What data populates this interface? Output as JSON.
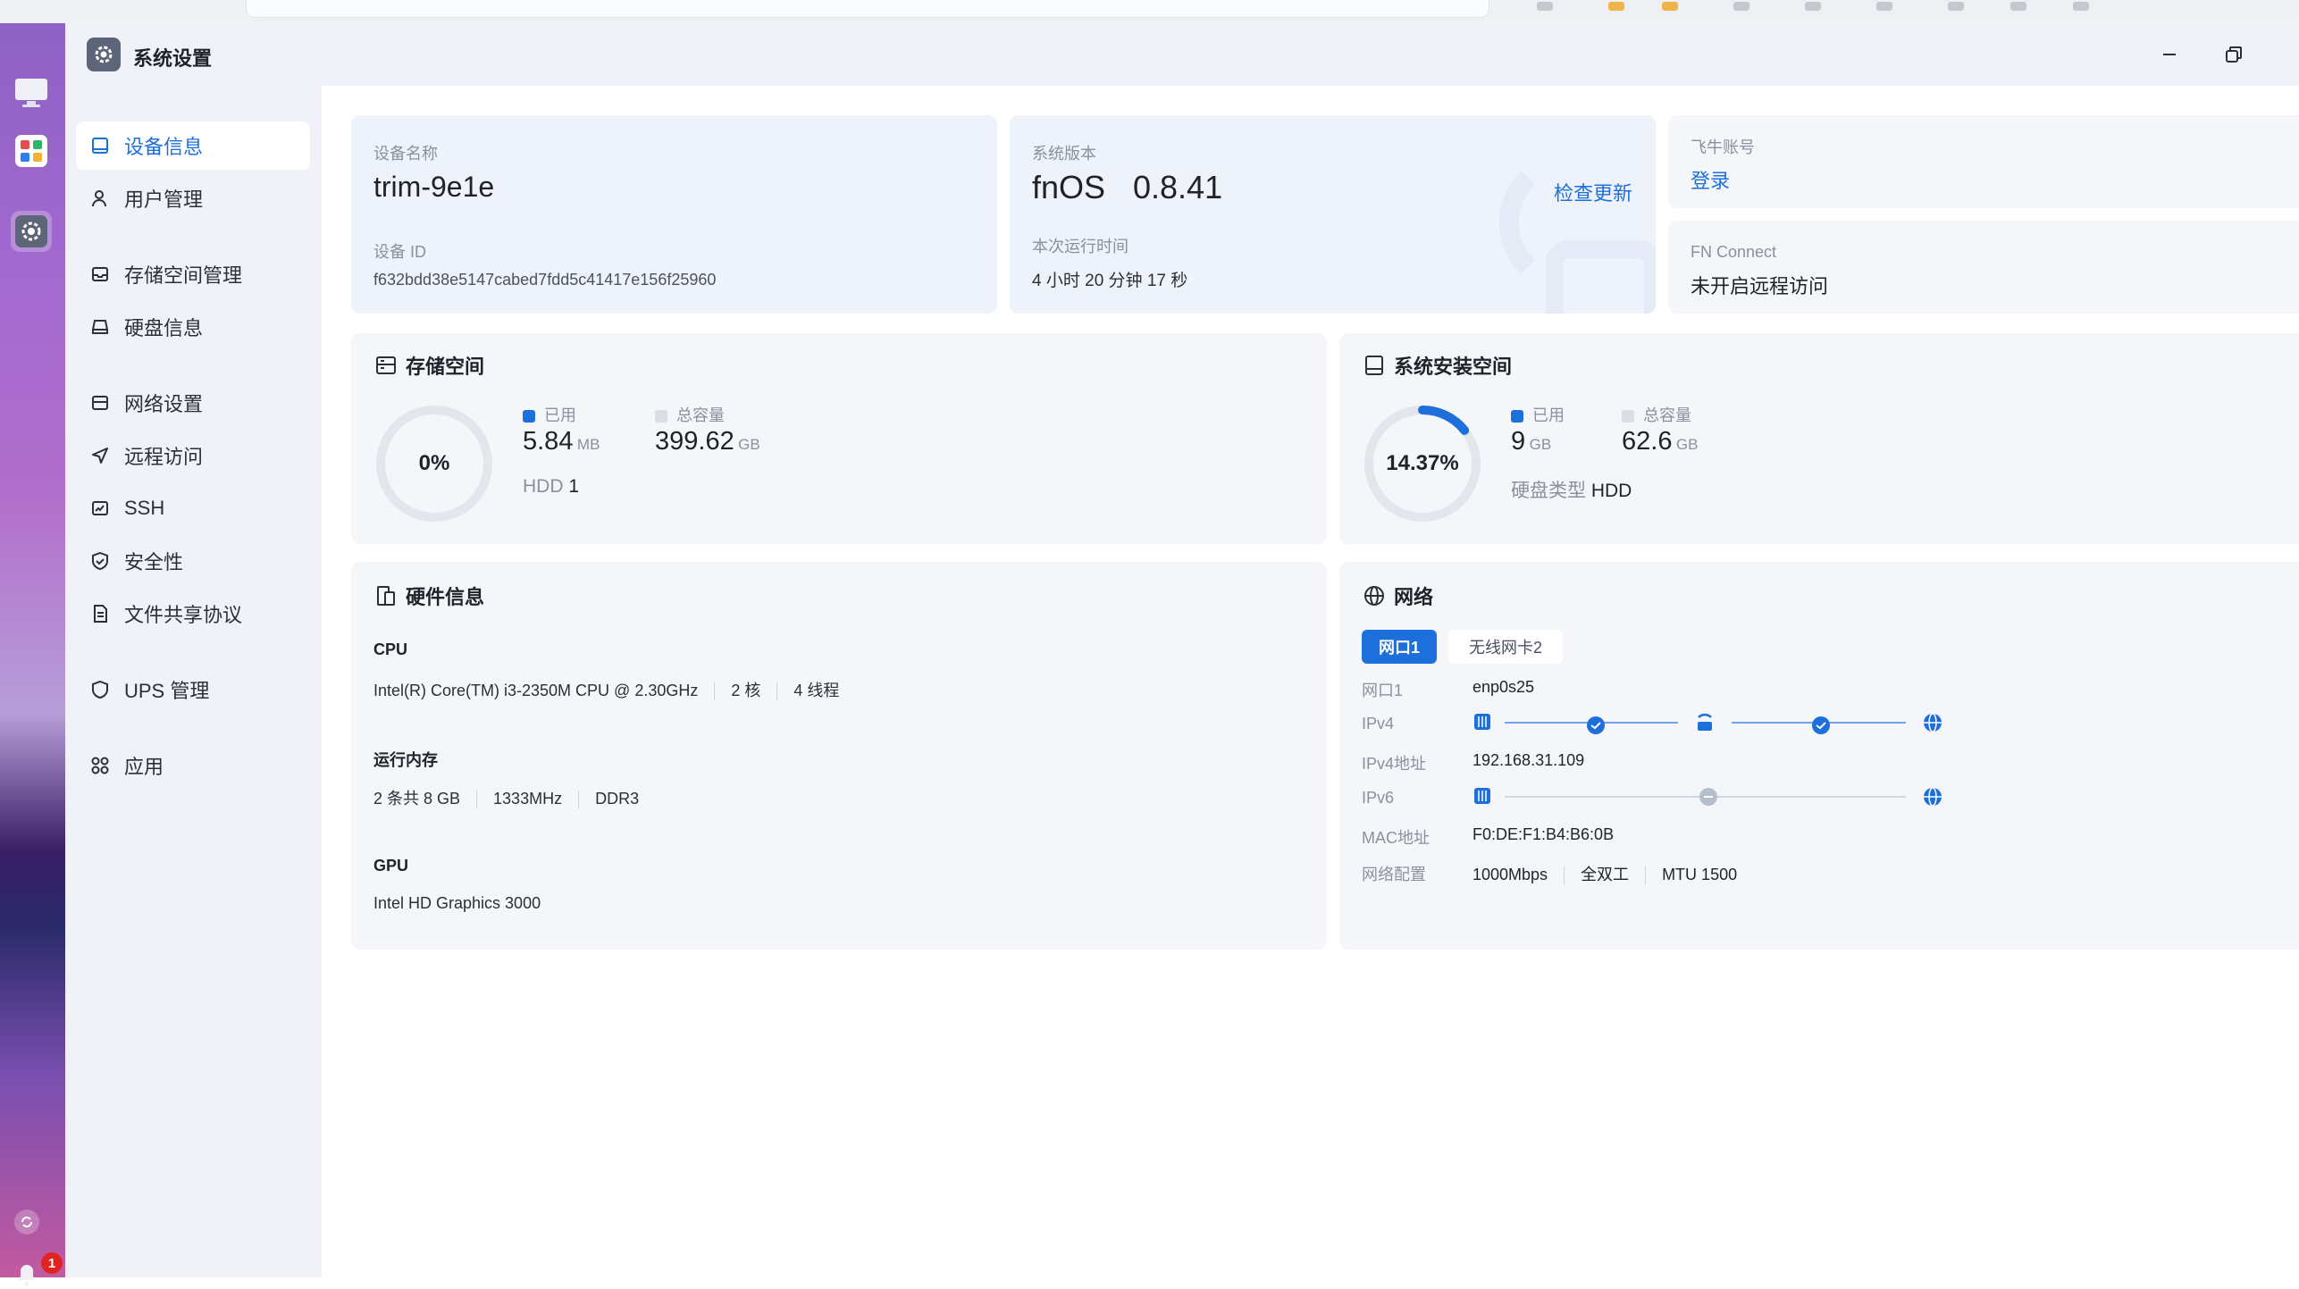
{
  "window": {
    "title": "系统设置"
  },
  "sidebar": {
    "items": [
      {
        "label": "设备信息",
        "icon": "device-icon"
      },
      {
        "label": "用户管理",
        "icon": "user-icon"
      },
      {
        "label": "存储空间管理",
        "icon": "storage-icon"
      },
      {
        "label": "硬盘信息",
        "icon": "disk-icon"
      },
      {
        "label": "网络设置",
        "icon": "network-icon"
      },
      {
        "label": "远程访问",
        "icon": "send-icon"
      },
      {
        "label": "SSH",
        "icon": "terminal-icon"
      },
      {
        "label": "安全性",
        "icon": "shield-check-icon"
      },
      {
        "label": "文件共享协议",
        "icon": "file-icon"
      },
      {
        "label": "UPS 管理",
        "icon": "shield-icon"
      },
      {
        "label": "应用",
        "icon": "apps-icon"
      }
    ]
  },
  "device": {
    "name_label": "设备名称",
    "name": "trim-9e1e",
    "id_label": "设备 ID",
    "id": "f632bdd38e5147cabed7fdd5c41417e156f25960"
  },
  "system": {
    "version_label": "系统版本",
    "os": "fnOS",
    "version": "0.8.41",
    "check_update": "检查更新",
    "uptime_label": "本次运行时间",
    "uptime": "4 小时 20 分钟 17 秒"
  },
  "account": {
    "label": "飞牛账号",
    "login": "登录",
    "fn_connect_label": "FN Connect",
    "fn_connect_status": "未开启远程访问"
  },
  "storage": {
    "title": "存储空间",
    "percent_text": "0%",
    "used_fraction": 0.0,
    "used_label": "已用",
    "used_value": "5.84",
    "used_unit": "MB",
    "total_label": "总容量",
    "total_value": "399.62",
    "total_unit": "GB",
    "disk_type": "HDD",
    "disk_count": "1"
  },
  "install": {
    "title": "系统安装空间",
    "percent_text": "14.37%",
    "used_fraction": 0.1437,
    "used_label": "已用",
    "used_value": "9",
    "used_unit": "GB",
    "total_label": "总容量",
    "total_value": "62.6",
    "total_unit": "GB",
    "disk_type_label": "硬盘类型",
    "disk_type": "HDD"
  },
  "hardware": {
    "title": "硬件信息",
    "cpu_label": "CPU",
    "cpu_model": "Intel(R) Core(TM) i3-2350M CPU @ 2.30GHz",
    "cpu_cores": "2 核",
    "cpu_threads": "4 线程",
    "mem_label": "运行内存",
    "mem_total": "2 条共 8 GB",
    "mem_freq": "1333MHz",
    "mem_type": "DDR3",
    "gpu_label": "GPU",
    "gpu_model": "Intel HD Graphics 3000"
  },
  "network": {
    "title": "网络",
    "tabs": [
      "网口1",
      "无线网卡2"
    ],
    "port_label": "网口1",
    "port_value": "enp0s25",
    "ipv4_label": "IPv4",
    "ipv4_addr_label": "IPv4地址",
    "ipv4_addr": "192.168.31.109",
    "ipv6_label": "IPv6",
    "mac_label": "MAC地址",
    "mac": "F0:DE:F1:B4:B6:0B",
    "config_label": "网络配置",
    "speed": "1000Mbps",
    "duplex": "全双工",
    "mtu": "MTU 1500"
  },
  "dock": {
    "notification_count": "1"
  },
  "colors": {
    "accent": "#1d6fdc",
    "ring_track": "#e3e6ec",
    "badge": "#e02424"
  }
}
